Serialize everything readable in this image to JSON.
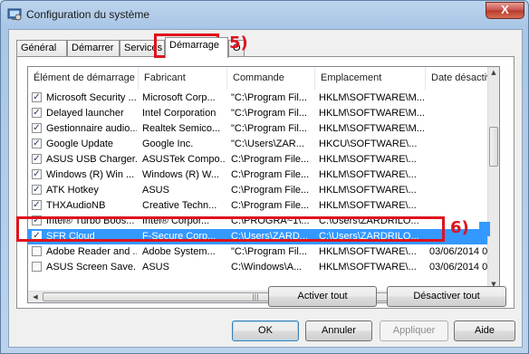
{
  "window": {
    "title": "Configuration du système",
    "close_glyph": "X",
    "accent": "#3399ff",
    "annotation_color": "#e0111d"
  },
  "tabs": [
    {
      "label": "Général"
    },
    {
      "label": "Démarrer"
    },
    {
      "label": "Services"
    },
    {
      "label": "Démarrage"
    },
    {
      "label": "O"
    }
  ],
  "active_tab": "Démarrage",
  "columns": [
    {
      "label": "Élément de démarrage"
    },
    {
      "label": "Fabricant"
    },
    {
      "label": "Commande"
    },
    {
      "label": "Emplacement"
    },
    {
      "label": "Date désactiv"
    }
  ],
  "rows": [
    {
      "checked": true,
      "item": "Microsoft Security ...",
      "maker": "Microsoft Corp...",
      "command": "\"C:\\Program Fil...",
      "location": "HKLM\\SOFTWARE\\M...",
      "date": ""
    },
    {
      "checked": true,
      "item": "Delayed launcher",
      "maker": "Intel Corporation",
      "command": "\"C:\\Program Fil...",
      "location": "HKLM\\SOFTWARE\\M...",
      "date": ""
    },
    {
      "checked": true,
      "item": "Gestionnaire audio...",
      "maker": "Realtek Semico...",
      "command": "\"C:\\Program Fil...",
      "location": "HKLM\\SOFTWARE\\M...",
      "date": ""
    },
    {
      "checked": true,
      "item": "Google Update",
      "maker": "Google Inc.",
      "command": "\"C:\\Users\\ZAR...",
      "location": "HKCU\\SOFTWARE\\...",
      "date": ""
    },
    {
      "checked": true,
      "item": "ASUS USB Charger...",
      "maker": "ASUSTek Compo...",
      "command": "C:\\Program File...",
      "location": "HKLM\\SOFTWARE\\...",
      "date": ""
    },
    {
      "checked": true,
      "item": "Windows (R) Win ...",
      "maker": "Windows (R) W...",
      "command": "C:\\Program File...",
      "location": "HKLM\\SOFTWARE\\...",
      "date": ""
    },
    {
      "checked": true,
      "item": "ATK Hotkey",
      "maker": "ASUS",
      "command": "C:\\Program File...",
      "location": "HKLM\\SOFTWARE\\...",
      "date": ""
    },
    {
      "checked": true,
      "item": "THXAudioNB",
      "maker": "Creative Techn...",
      "command": "C:\\Program File...",
      "location": "HKLM\\SOFTWARE\\...",
      "date": ""
    },
    {
      "checked": true,
      "item": "Intel® Turbo Boos...",
      "maker": "Intel® Corpor...",
      "command": "C:\\PROGRA~1\\...",
      "location": "C:\\Users\\ZARDRILO...",
      "date": ""
    },
    {
      "checked": true,
      "item": "SFR Cloud",
      "maker": "F-Secure Corp...",
      "command": "C:\\Users\\ZARD...",
      "location": "C:\\Users\\ZARDRILO...",
      "date": "",
      "selected": true
    },
    {
      "checked": false,
      "item": "Adobe Reader and ...",
      "maker": "Adobe System...",
      "command": "\"C:\\Program Fil...",
      "location": "HKLM\\SOFTWARE\\...",
      "date": "03/06/2014 0"
    },
    {
      "checked": false,
      "item": "ASUS Screen Save...",
      "maker": "ASUS",
      "command": "C:\\Windows\\A...",
      "location": "HKLM\\SOFTWARE\\...",
      "date": "03/06/2014 0"
    }
  ],
  "actions": {
    "enable_all": "Activer tout",
    "disable_all": "Désactiver tout"
  },
  "footer": {
    "ok": "OK",
    "cancel": "Annuler",
    "apply": "Appliquer",
    "help": "Aide"
  },
  "annotations": {
    "step5": "5)",
    "step6": "6)"
  }
}
